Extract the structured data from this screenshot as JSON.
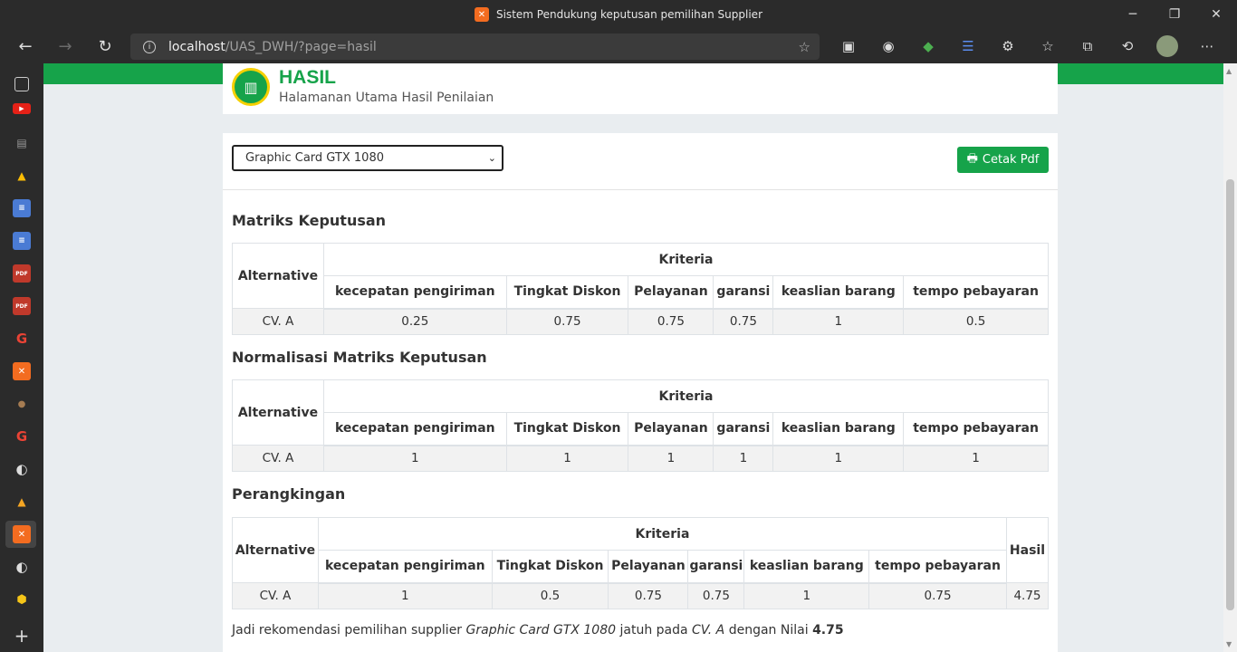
{
  "browser": {
    "window_title": "Sistem Pendukung keputusan pemilihan Supplier",
    "url_host": "localhost",
    "url_path": "/UAS_DWH/?page=hasil"
  },
  "header": {
    "title": "HASIL",
    "subtitle": "Halamanan Utama Hasil Penilaian"
  },
  "controls": {
    "selected_product": "Graphic Card GTX 1080",
    "print_button": "Cetak Pdf"
  },
  "criteria_header": "Kriteria",
  "alternative_header": "Alternative",
  "result_header": "Hasil",
  "criteria": [
    "kecepatan pengiriman",
    "Tingkat Diskon",
    "Pelayanan",
    "garansi",
    "keaslian barang",
    "tempo pebayaran"
  ],
  "matriks": {
    "title": "Matriks Keputusan",
    "rows": [
      {
        "alternative": "CV. A",
        "values": [
          "0.25",
          "0.75",
          "0.75",
          "0.75",
          "1",
          "0.5"
        ]
      }
    ]
  },
  "normalisasi": {
    "title": "Normalisasi Matriks Keputusan",
    "rows": [
      {
        "alternative": "CV. A",
        "values": [
          "1",
          "1",
          "1",
          "1",
          "1",
          "1"
        ]
      }
    ]
  },
  "perangkingan": {
    "title": "Perangkingan",
    "rows": [
      {
        "alternative": "CV. A",
        "values": [
          "1",
          "0.5",
          "0.75",
          "0.75",
          "1",
          "0.75"
        ],
        "hasil": "4.75"
      }
    ]
  },
  "conclusion": {
    "prefix": "Jadi rekomendasi pemilihan supplier",
    "product": "Graphic Card GTX 1080",
    "middle": "jatuh pada",
    "supplier": "CV. A",
    "suffix": "dengan Nilai",
    "score": "4.75"
  }
}
